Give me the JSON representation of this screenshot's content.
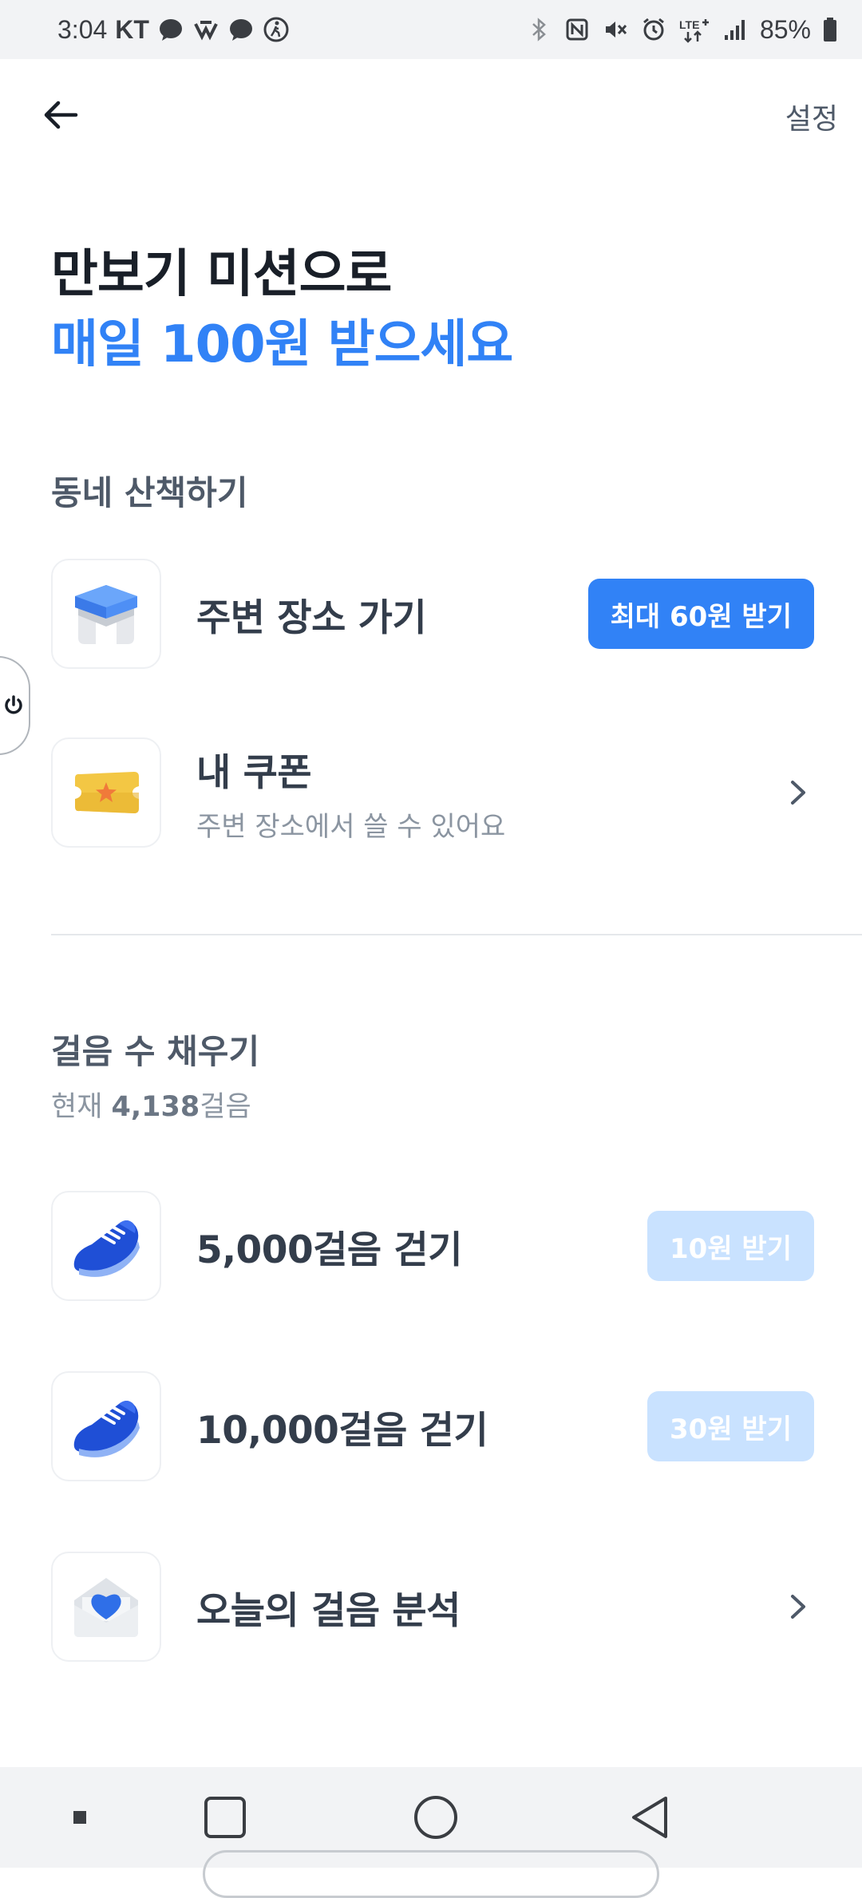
{
  "status_bar": {
    "time": "3:04",
    "carrier": "KT",
    "battery": "85%"
  },
  "header": {
    "settings_label": "설정"
  },
  "headline": {
    "line1": "만보기 미션으로",
    "line2": "매일 100원 받으세요"
  },
  "walk_section": {
    "title": "동네 산책하기",
    "items": [
      {
        "title": "주변 장소 가기",
        "button": "최대 60원 받기",
        "icon": "blue-box-icon"
      },
      {
        "title": "내 쿠폰",
        "subtitle": "주변 장소에서 쓸 수 있어요",
        "icon": "coupon-ticket-icon"
      }
    ]
  },
  "steps_section": {
    "title": "걸음 수 채우기",
    "current_prefix": "현재 ",
    "current_steps": "4,138",
    "current_suffix": "걸음",
    "items": [
      {
        "title": "5,000걸음 걷기",
        "button": "10원 받기",
        "icon": "blue-sneaker-icon"
      },
      {
        "title": "10,000걸음 걷기",
        "button": "30원 받기",
        "icon": "blue-sneaker-icon"
      },
      {
        "title": "오늘의 걸음 분석",
        "icon": "heart-envelope-icon"
      }
    ]
  },
  "colors": {
    "accent": "#3182f6",
    "accent_disabled": "#c9e2ff",
    "text_primary": "#191f28",
    "text_secondary": "#8b95a1"
  }
}
